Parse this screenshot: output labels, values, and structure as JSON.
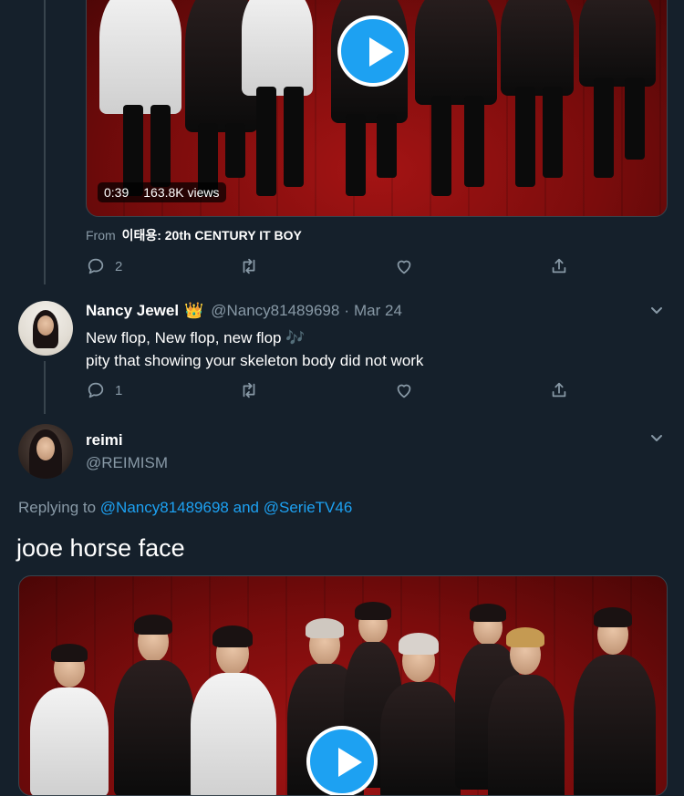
{
  "video1": {
    "duration": "0:39",
    "views": "163.8K views",
    "source_prefix": "From",
    "source_name": "이태용: 20th CENTURY IT BOY"
  },
  "tweet_actions_1": {
    "replies": "2"
  },
  "tweet2": {
    "display_name": "Nancy Jewel",
    "emoji": "👑",
    "handle": "@Nancy81489698",
    "separator": "·",
    "date": "Mar 24",
    "line1": "New flop, New flop, new flop",
    "line1_emoji": "🎶",
    "line2": "pity that showing your skeleton body did not work",
    "replies": "1"
  },
  "tweet3": {
    "display_name": "reimi",
    "handle": "@REIMISM",
    "replying_label": "Replying to",
    "reply_to_1": "@Nancy81489698",
    "reply_and": "and",
    "reply_to_2": "@SerieTV46",
    "body": "jooe horse face"
  },
  "icons": [
    "reply-icon",
    "retweet-icon",
    "like-icon",
    "share-icon",
    "chevron-down-icon",
    "play-icon"
  ],
  "colors": {
    "background": "#15202b",
    "accent": "#1da1f2",
    "muted": "#8899a6",
    "border": "#38444d"
  }
}
